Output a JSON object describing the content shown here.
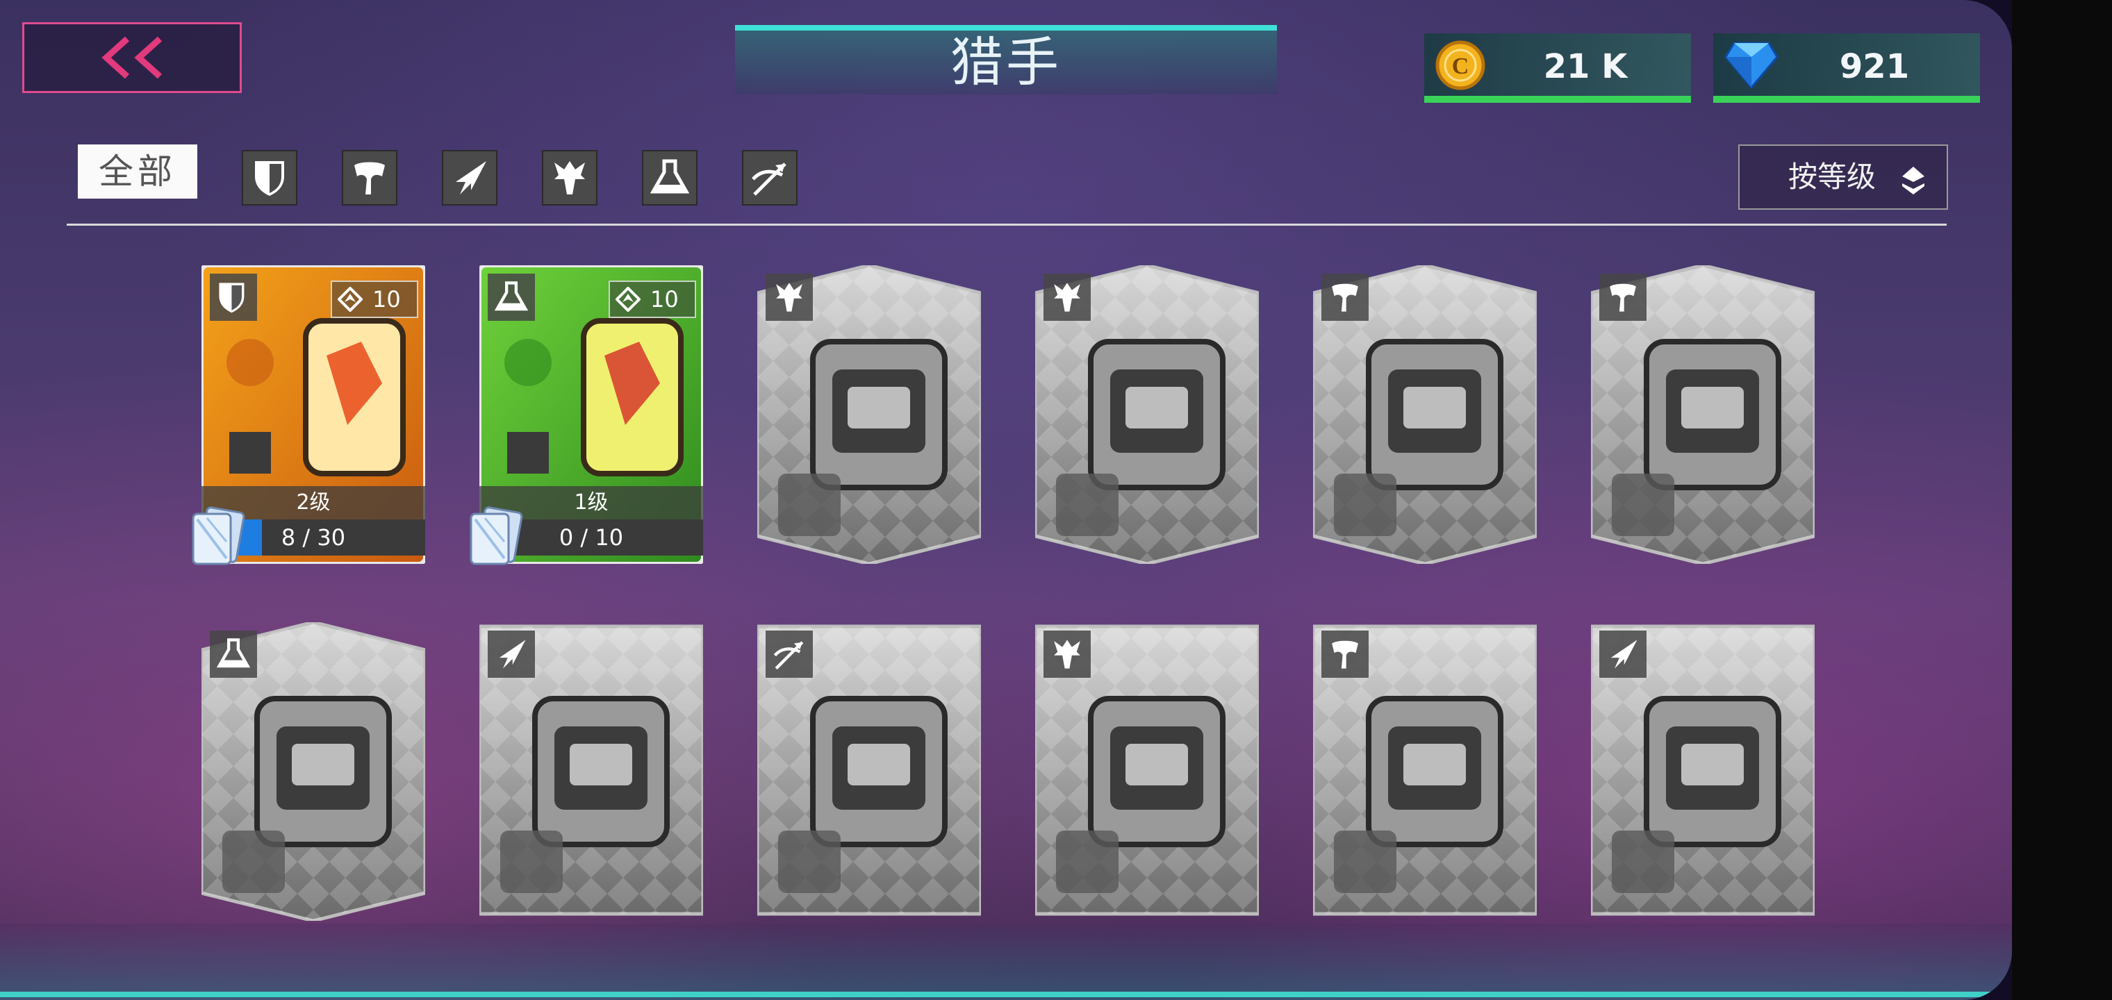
{
  "header": {
    "title": "猎手",
    "back_icon": "double-chevron-left-icon"
  },
  "currencies": {
    "coins": {
      "icon": "coin-icon",
      "amount": "21 K"
    },
    "gems": {
      "icon": "diamond-icon",
      "amount": "921"
    }
  },
  "filters": {
    "all_label": "全部",
    "classes": [
      "shield-icon",
      "axe-icon",
      "blade-icon",
      "spikes-icon",
      "flask-icon",
      "bow-icon"
    ]
  },
  "sort": {
    "label": "按等级",
    "icon": "sort-diamond-icon"
  },
  "colors": {
    "accent_pink": "#e04a8e",
    "accent_cyan": "#3fe0d8",
    "progress_blue": "#1e7de0",
    "currency_green": "#39d35a"
  },
  "hunters": [
    {
      "class_icon": "shield-icon",
      "unlocked": true,
      "rank": "10",
      "level": "2级",
      "progress": "8 / 30",
      "progress_fraction": 0.267,
      "theme": "orange"
    },
    {
      "class_icon": "flask-icon",
      "unlocked": true,
      "rank": "10",
      "level": "1级",
      "progress": "0 / 10",
      "progress_fraction": 0.0,
      "theme": "green"
    },
    {
      "class_icon": "spikes-icon",
      "unlocked": false
    },
    {
      "class_icon": "spikes-icon",
      "unlocked": false
    },
    {
      "class_icon": "axe-icon",
      "unlocked": false
    },
    {
      "class_icon": "axe-icon",
      "unlocked": false
    },
    {
      "class_icon": "flask-icon",
      "unlocked": false
    },
    {
      "class_icon": "blade-icon",
      "unlocked": false
    },
    {
      "class_icon": "bow-icon",
      "unlocked": false
    },
    {
      "class_icon": "spikes-icon",
      "unlocked": false
    },
    {
      "class_icon": "axe-icon",
      "unlocked": false
    },
    {
      "class_icon": "blade-icon",
      "unlocked": false
    }
  ]
}
